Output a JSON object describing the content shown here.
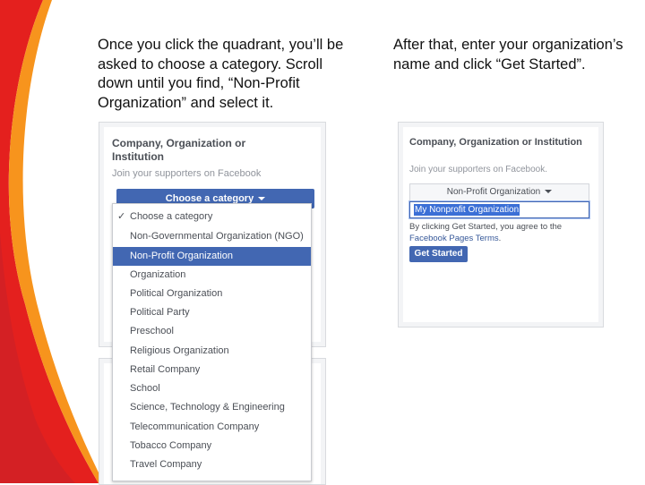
{
  "captions": {
    "left": "Once you click the quadrant, you’ll be asked to choose a category. Scroll down until you find, “Non-Profit Organization” and select it.",
    "right": "After that, enter your organization’s name and click “Get Started”."
  },
  "left_panel": {
    "title": "Company, Organization or Institution",
    "subtitle": "Join your supporters on Facebook",
    "category_button_label": "Choose a category",
    "dropdown_items": [
      {
        "label": "Choose a category",
        "checked": true,
        "selected": false
      },
      {
        "label": "Non-Governmental Organization (NGO)",
        "checked": false,
        "selected": false
      },
      {
        "label": "Non-Profit Organization",
        "checked": false,
        "selected": true
      },
      {
        "label": "Organization",
        "checked": false,
        "selected": false
      },
      {
        "label": "Political Organization",
        "checked": false,
        "selected": false
      },
      {
        "label": "Political Party",
        "checked": false,
        "selected": false
      },
      {
        "label": "Preschool",
        "checked": false,
        "selected": false
      },
      {
        "label": "Religious Organization",
        "checked": false,
        "selected": false
      },
      {
        "label": "Retail Company",
        "checked": false,
        "selected": false
      },
      {
        "label": "School",
        "checked": false,
        "selected": false
      },
      {
        "label": "Science, Technology & Engineering",
        "checked": false,
        "selected": false
      },
      {
        "label": "Telecommunication Company",
        "checked": false,
        "selected": false
      },
      {
        "label": "Tobacco Company",
        "checked": false,
        "selected": false
      },
      {
        "label": "Travel Company",
        "checked": false,
        "selected": false
      }
    ]
  },
  "right_panel": {
    "title": "Company, Organization or Institution",
    "subtitle": "Join your supporters on Facebook.",
    "selected_category": "Non-Profit Organization",
    "name_input_value": "My Nonprofit Organization",
    "agreement_prefix": "By clicking Get Started, you agree to the",
    "agreement_link": "Facebook Pages Terms",
    "agreement_suffix": ".",
    "get_started_label": "Get Started"
  },
  "colors": {
    "facebook_blue": "#4267b2",
    "swoosh_red": "#e4201e",
    "swoosh_orange": "#f7941d"
  }
}
